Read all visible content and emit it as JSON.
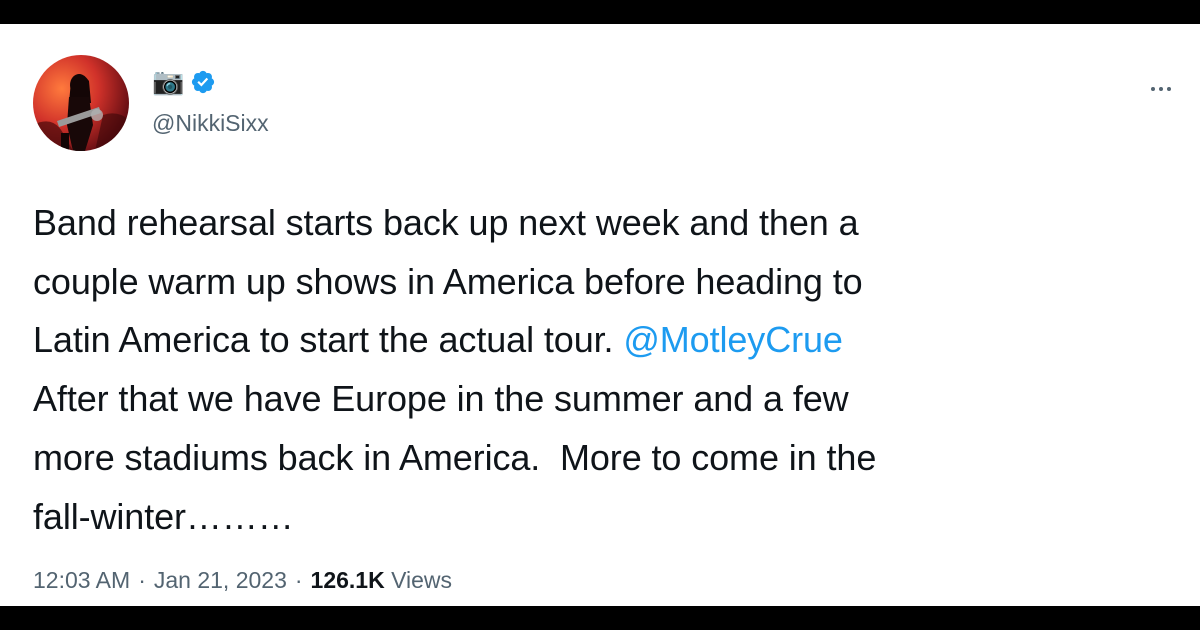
{
  "author": {
    "display_name_emoji": "📷",
    "handle": "@NikkiSixx",
    "verified": true
  },
  "tweet": {
    "line1": "Band rehearsal starts back up next week and then a",
    "line2": "couple warm up shows in America before heading to",
    "line3_prefix": "Latin America to start the actual tour. ",
    "mention": "@MotleyCrue",
    "line4": "After that we have Europe in the summer and a few",
    "line5": "more stadiums back in America.  More to come in the",
    "line6": "fall-winter………"
  },
  "meta": {
    "time": "12:03 AM",
    "separator": "·",
    "date": "Jan 21, 2023",
    "views_count": "126.1K",
    "views_label": "Views"
  },
  "colors": {
    "accent": "#1d9bf0",
    "text": "#0f1419",
    "secondary": "#536471"
  },
  "icons": {
    "more": "more-horizontal-icon",
    "verified": "verified-badge-icon"
  }
}
